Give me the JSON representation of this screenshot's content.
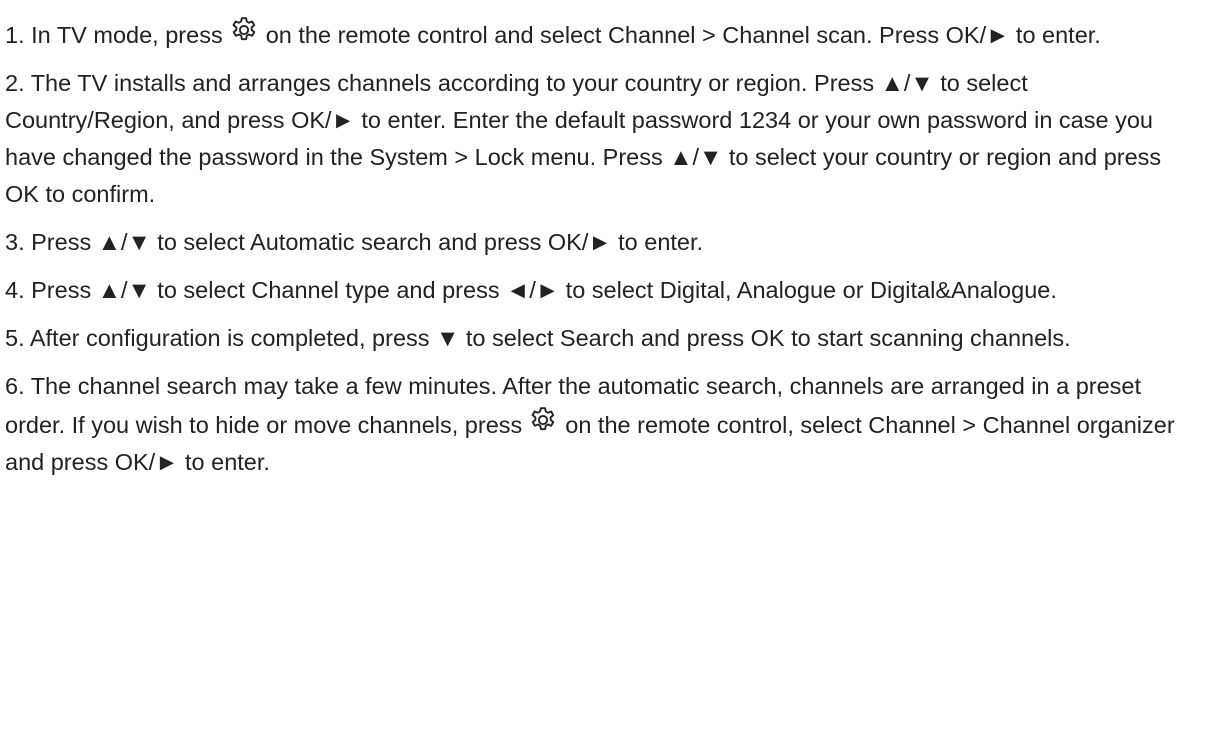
{
  "icons": {
    "settings": "gear-icon"
  },
  "steps": [
    {
      "before_icon": "1. In TV mode, press",
      "after_icon": "on the remote control and select Channel > Channel scan. Press OK/► to enter."
    },
    {
      "text": "2. The TV installs and arranges channels according to your country or region. Press ▲/▼ to select Country/Region, and press OK/► to enter. Enter the default password 1234 or your own password in case you have changed the password in the System > Lock menu. Press ▲/▼ to select your country or region and press OK to confirm."
    },
    {
      "text": "3. Press ▲/▼ to select Automatic search and press OK/► to enter."
    },
    {
      "text": "4. Press ▲/▼ to select Channel type and press ◄/► to select Digital, Analogue or Digital&Analogue."
    },
    {
      "text": "5. After configuration is completed, press ▼ to select Search and press OK to start scanning channels."
    },
    {
      "before_icon": "6. The channel search may take a few minutes. After the automatic search, channels are arranged in a preset order. If you wish to hide or move channels, press",
      "after_icon": "on the remote control, select Channel > Channel organizer and press OK/► to enter."
    }
  ]
}
